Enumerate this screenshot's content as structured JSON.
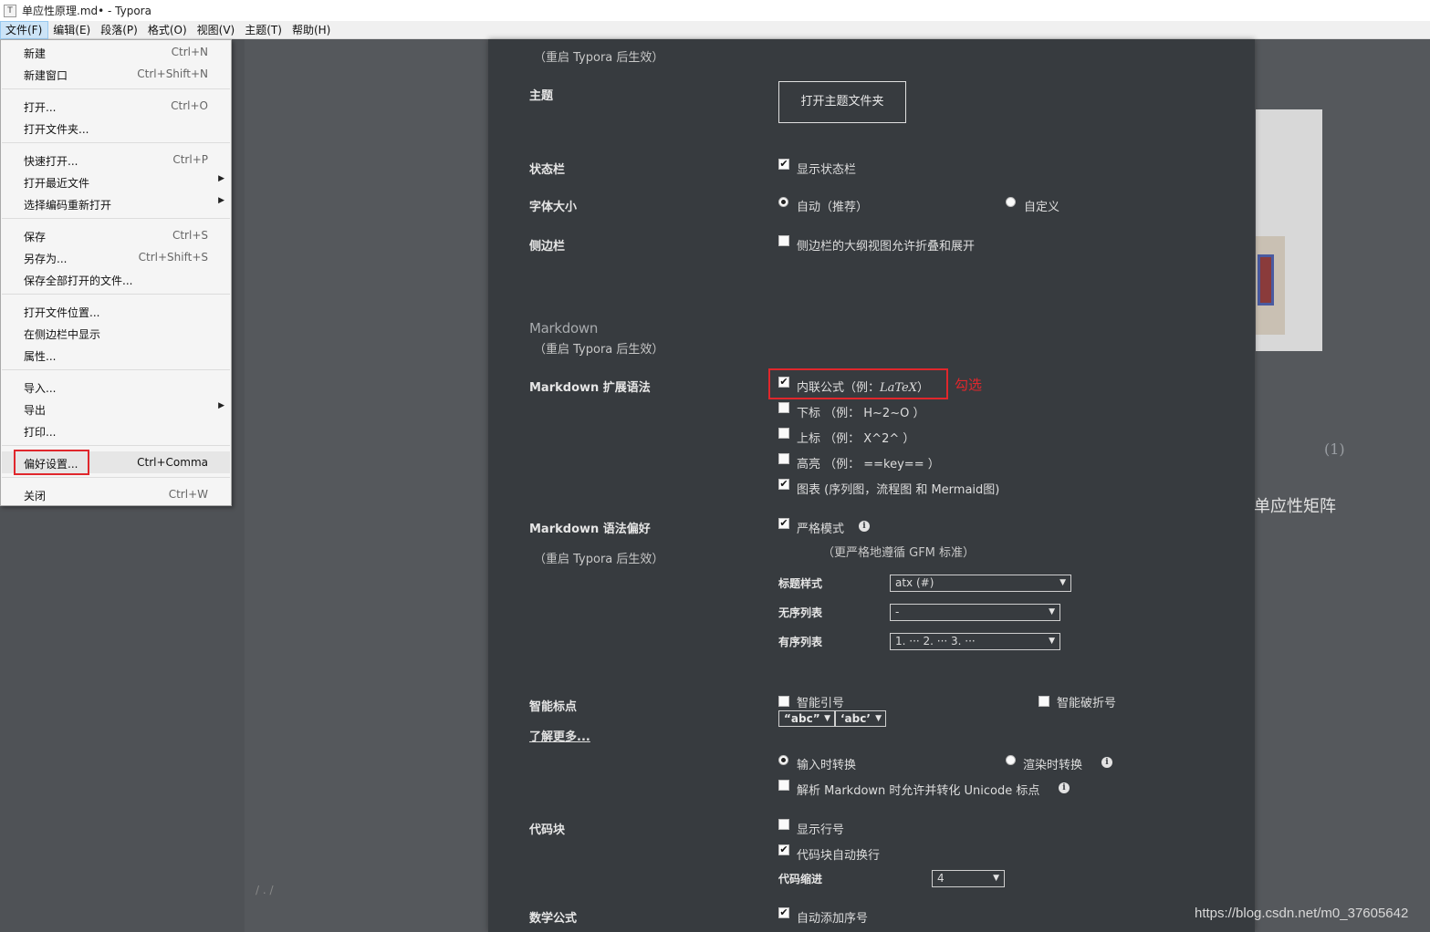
{
  "window": {
    "title": "单应性原理.md• - Typora",
    "icon_glyph": "T"
  },
  "menubar": [
    "文件(F)",
    "编辑(E)",
    "段落(P)",
    "格式(O)",
    "视图(V)",
    "主题(T)",
    "帮助(H)"
  ],
  "file_menu": {
    "groups": [
      [
        {
          "label": "新建",
          "shortcut": "Ctrl+N"
        },
        {
          "label": "新建窗口",
          "shortcut": "Ctrl+Shift+N"
        }
      ],
      [
        {
          "label": "打开...",
          "shortcut": "Ctrl+O"
        },
        {
          "label": "打开文件夹...",
          "shortcut": ""
        }
      ],
      [
        {
          "label": "快速打开...",
          "shortcut": "Ctrl+P"
        },
        {
          "label": "打开最近文件",
          "shortcut": "",
          "submenu": true
        },
        {
          "label": "选择编码重新打开",
          "shortcut": "",
          "submenu": true
        }
      ],
      [
        {
          "label": "保存",
          "shortcut": "Ctrl+S"
        },
        {
          "label": "另存为...",
          "shortcut": "Ctrl+Shift+S"
        },
        {
          "label": "保存全部打开的文件...",
          "shortcut": ""
        }
      ],
      [
        {
          "label": "打开文件位置...",
          "shortcut": ""
        },
        {
          "label": "在侧边栏中显示",
          "shortcut": ""
        },
        {
          "label": "属性...",
          "shortcut": ""
        }
      ],
      [
        {
          "label": "导入...",
          "shortcut": ""
        },
        {
          "label": "导出",
          "shortcut": "",
          "submenu": true
        },
        {
          "label": "打印...",
          "shortcut": ""
        }
      ],
      [
        {
          "label": "偏好设置...",
          "shortcut": "Ctrl+Comma",
          "highlighted": true
        }
      ],
      [
        {
          "label": "关闭",
          "shortcut": "Ctrl+W"
        }
      ]
    ],
    "submenu_glyph": "▶"
  },
  "preferences": {
    "restart_note": "（重启 Typora 后生效）",
    "theme": {
      "label": "主题",
      "button": "打开主题文件夹"
    },
    "status_bar": {
      "label": "状态栏",
      "option": "显示状态栏",
      "checked": true
    },
    "font_size": {
      "label": "字体大小",
      "auto": "自动（推荐）",
      "custom": "自定义",
      "selected": "auto"
    },
    "sidebar": {
      "label": "侧边栏",
      "option": "侧边栏的大纲视图允许折叠和展开",
      "checked": false
    },
    "markdown_section": {
      "title": "Markdown",
      "note": "（重启 Typora 后生效）"
    },
    "syntax_ext": {
      "label": "Markdown 扩展语法",
      "inline_math_label": "内联公式（例：",
      "inline_math_latex": "LaTeX",
      "inline_math_close": "）",
      "inline_math_checked": true,
      "subscript": "下标 （例： H~2~O ）",
      "subscript_checked": false,
      "superscript": "上标 （例： X^2^ ）",
      "superscript_checked": false,
      "highlight": "高亮 （例： ==key== ）",
      "highlight_checked": false,
      "diagrams": "图表 (序列图，流程图 和 Mermaid图)",
      "diagrams_checked": true
    },
    "annotation": "勾选",
    "syntax_pref": {
      "label": "Markdown 语法偏好",
      "note": "（重启 Typora 后生效）",
      "strict_mode": "严格模式",
      "strict_checked": true,
      "strict_note": "（更严格地遵循 GFM 标准）",
      "heading_style_label": "标题样式",
      "heading_style_value": "atx (#)",
      "unordered_label": "无序列表",
      "unordered_value": "-",
      "ordered_label": "有序列表",
      "ordered_value": "1. ··· 2. ··· 3. ···"
    },
    "smart_punct": {
      "label": "智能标点",
      "learn_more": "了解更多...",
      "smart_quotes": "智能引号",
      "smart_quotes_checked": false,
      "smart_dashes": "智能破折号",
      "smart_dashes_checked": false,
      "double_quote_value": "“abc”",
      "single_quote_value": "‘abc’",
      "convert_on_input": "输入时转换",
      "convert_on_render": "渲染时转换",
      "convert_selected": "input",
      "unicode_option": "解析 Markdown 时允许并转化 Unicode 标点",
      "unicode_checked": false
    },
    "code_block": {
      "label": "代码块",
      "line_numbers": "显示行号",
      "line_numbers_checked": false,
      "wrap": "代码块自动换行",
      "wrap_checked": true,
      "indent_label": "代码缩进",
      "indent_value": "4"
    },
    "math": {
      "label": "数学公式",
      "auto_number": "自动添加序号",
      "auto_number_checked": true
    }
  },
  "document": {
    "equation_number": "(1)",
    "heading_fragment": "单应性矩阵",
    "footer_fragment": "/ . /"
  },
  "watermark": "https://blog.csdn.net/m0_37605642",
  "glyphs": {
    "check": "✔",
    "dropdown_arrow": "▼",
    "info": "i"
  },
  "colors": {
    "panel_bg": "#373b3f",
    "workspace_bg": "#55585c",
    "highlight_red": "#e0272c"
  }
}
